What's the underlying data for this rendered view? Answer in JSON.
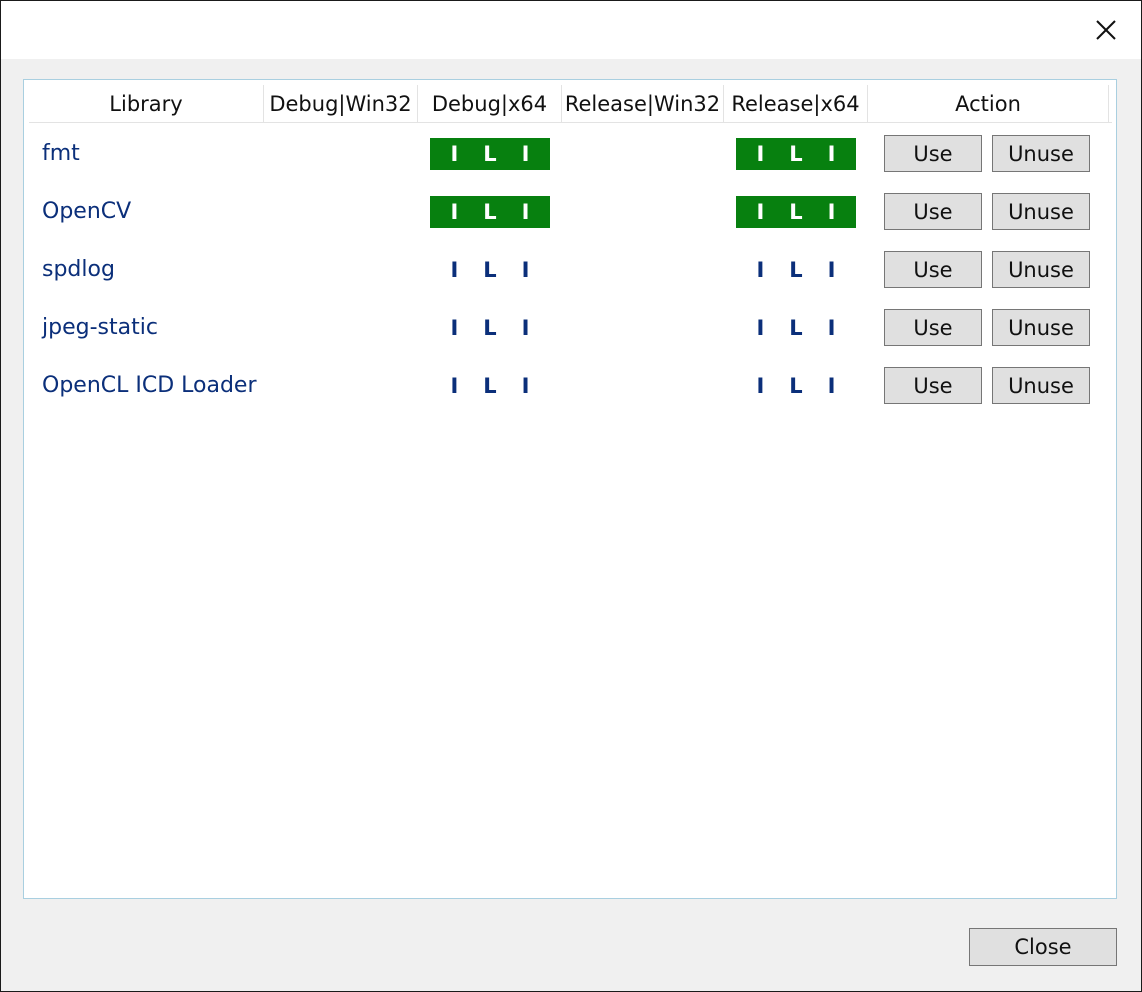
{
  "dialog": {
    "columns": [
      "Library",
      "Debug|Win32",
      "Debug|x64",
      "Release|Win32",
      "Release|x64",
      "Action"
    ],
    "indicator_letters": [
      "I",
      "L",
      "I"
    ],
    "rows": [
      {
        "name": "fmt",
        "debug_x64_active": true,
        "release_x64_active": true,
        "use_label": "Use",
        "unuse_label": "Unuse"
      },
      {
        "name": "OpenCV",
        "debug_x64_active": true,
        "release_x64_active": true,
        "use_label": "Use",
        "unuse_label": "Unuse"
      },
      {
        "name": "spdlog",
        "debug_x64_active": false,
        "release_x64_active": false,
        "use_label": "Use",
        "unuse_label": "Unuse"
      },
      {
        "name": "jpeg-static",
        "debug_x64_active": false,
        "release_x64_active": false,
        "use_label": "Use",
        "unuse_label": "Unuse"
      },
      {
        "name": "OpenCL ICD Loader",
        "debug_x64_active": false,
        "release_x64_active": false,
        "use_label": "Use",
        "unuse_label": "Unuse"
      }
    ],
    "close_label": "Close",
    "colors": {
      "active": "#07800f",
      "text_link": "#0b2f7a",
      "border": "#a9cfe0"
    },
    "icons": {
      "title_close": "close-icon"
    }
  }
}
